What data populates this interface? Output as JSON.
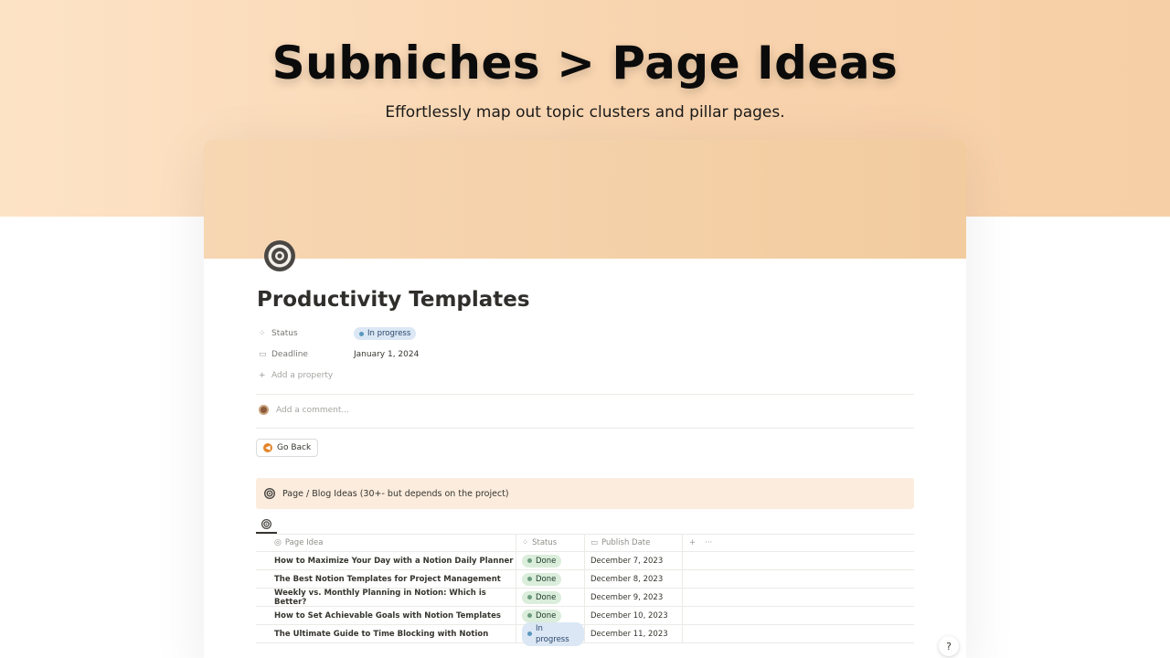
{
  "hero": {
    "title": "Subniches > Page Ideas",
    "subtitle": "Effortlessly map out topic clusters and pillar pages."
  },
  "page": {
    "icon": "target-icon",
    "title": "Productivity Templates",
    "properties": [
      {
        "icon": "status-spinner-icon",
        "label": "Status",
        "value": "In progress",
        "type": "status"
      },
      {
        "icon": "calendar-icon",
        "label": "Deadline",
        "value": "January 1, 2024",
        "type": "date"
      }
    ],
    "add_property": "Add a property",
    "comment_placeholder": "Add a comment...",
    "go_back_label": "Go Back",
    "callout_text": "Page / Blog Ideas (30+- but depends on the project)"
  },
  "table": {
    "columns": {
      "idea": "Page Idea",
      "status": "Status",
      "date": "Publish Date"
    },
    "rows": [
      {
        "idea": "How to Maximize Your Day with a Notion Daily Planner",
        "status": "Done",
        "date": "December 7, 2023"
      },
      {
        "idea": "The Best Notion Templates for Project Management",
        "status": "Done",
        "date": "December 8, 2023"
      },
      {
        "idea": "Weekly vs. Monthly Planning in Notion: Which is Better?",
        "status": "Done",
        "date": "December 9, 2023"
      },
      {
        "idea": "How to Set Achievable Goals with Notion Templates",
        "status": "Done",
        "date": "December 10, 2023"
      },
      {
        "idea": "The Ultimate Guide to Time Blocking with Notion",
        "status": "In progress",
        "date": "December 11, 2023"
      }
    ]
  },
  "help_label": "?",
  "colors": {
    "hero_bg": "#fde3c6",
    "cover_bg": "#f2cc9f",
    "callout_bg": "#fbecdd",
    "done_badge": "#dbeddb",
    "progress_badge": "#dbe7f4"
  }
}
